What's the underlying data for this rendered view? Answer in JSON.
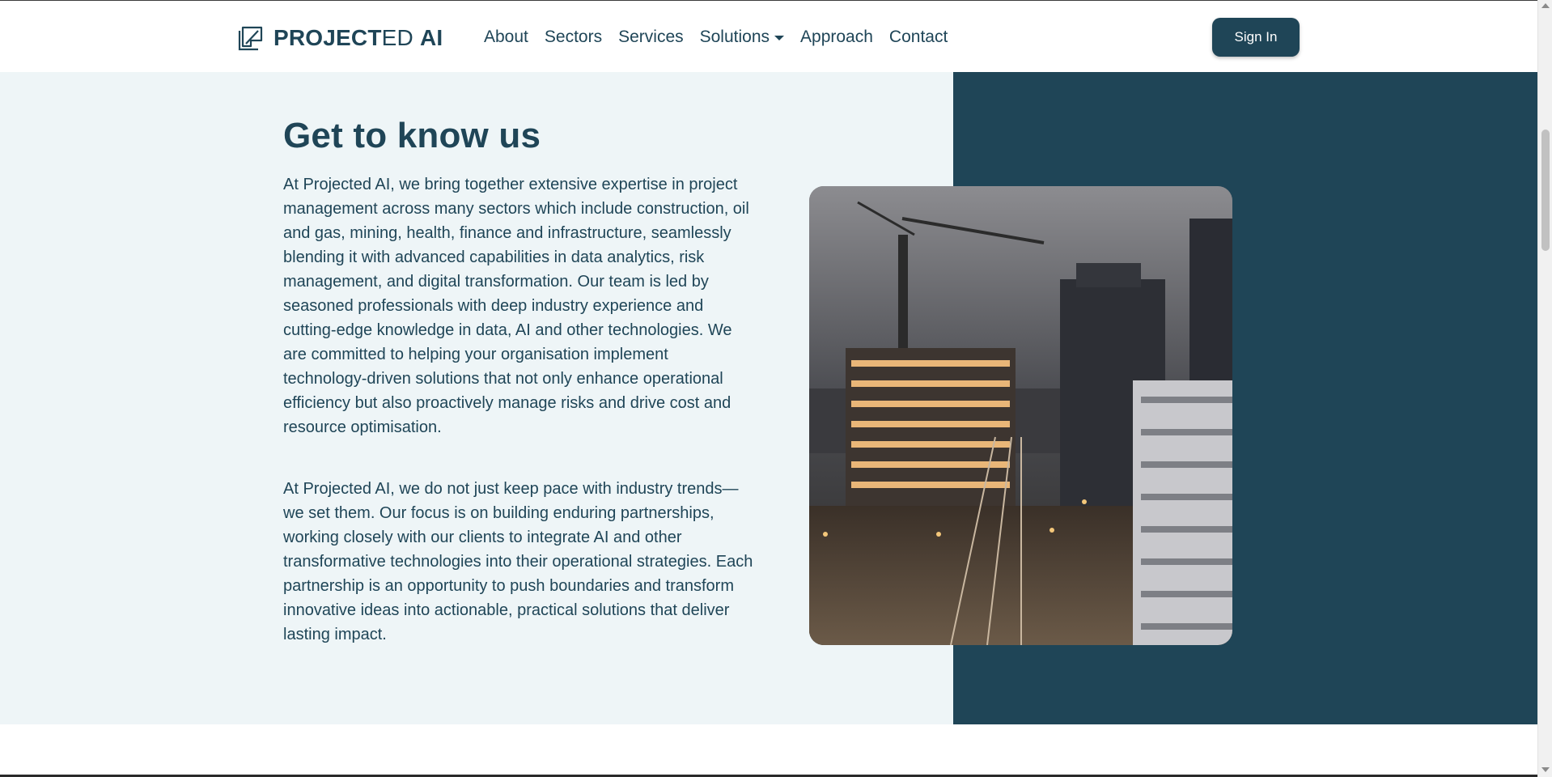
{
  "brand": {
    "name_bold": "PROJECT",
    "name_light": "ED",
    "name_suffix": "AI",
    "color": "#1f4557",
    "icon": "projected-logo-icon"
  },
  "nav": {
    "items": [
      {
        "label": "About"
      },
      {
        "label": "Sectors"
      },
      {
        "label": "Services"
      },
      {
        "label": "Solutions",
        "has_dropdown": true
      },
      {
        "label": "Approach"
      },
      {
        "label": "Contact"
      }
    ],
    "sign_in_label": "Sign In"
  },
  "about": {
    "heading": "Get to know us",
    "paragraph_1": "At Projected AI, we bring together extensive expertise in project management across many sectors which include construction, oil and gas, mining, health, finance and infrastructure, seamlessly blending it with advanced capabilities in data analytics, risk management, and digital transformation. Our team is led by seasoned professionals with deep industry experience and cutting-edge knowledge in data, AI and other technologies. We are committed to helping your organisation implement technology-driven solutions that not only enhance operational efficiency but also proactively manage risks and drive cost and resource optimisation.",
    "paragraph_2": "At Projected AI, we do not just keep pace with industry trends—we set them. Our focus is on building enduring partnerships, working closely with our clients to integrate AI and other transformative technologies into their operational strategies. Each partnership is an opportunity to push boundaries and transform innovative ideas into actionable, practical solutions that deliver lasting impact.",
    "image_alt": "construction-site-city-night-photo"
  },
  "colors": {
    "primary": "#1f4557",
    "section_bg": "#eef5f7"
  }
}
